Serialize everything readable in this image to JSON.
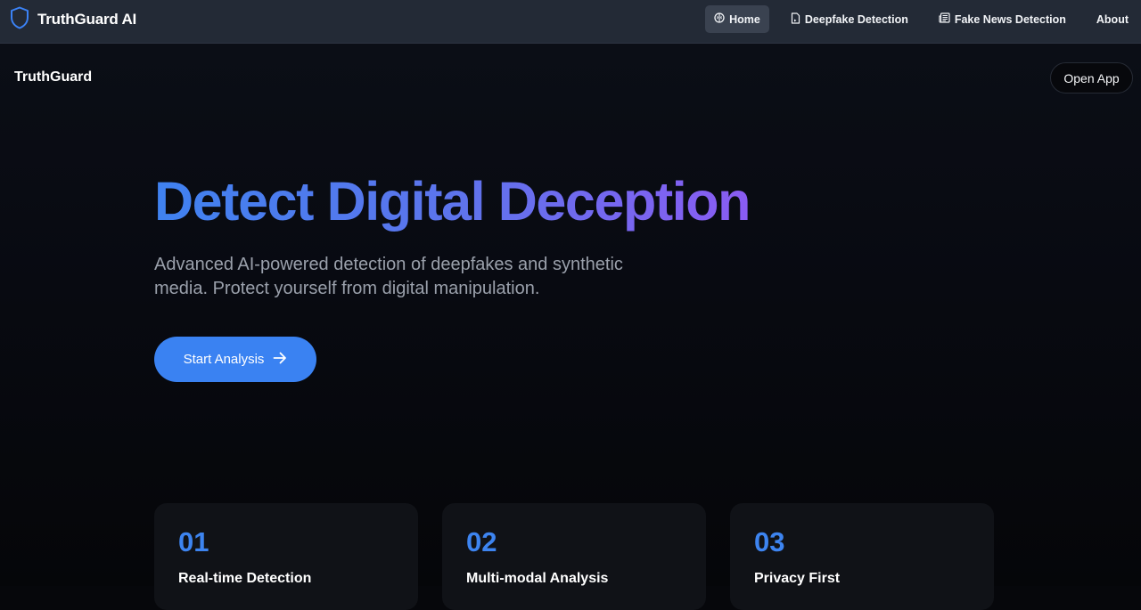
{
  "topbar": {
    "brand": "TruthGuard AI",
    "nav": [
      {
        "label": "Home",
        "icon": "brain-icon",
        "active": true
      },
      {
        "label": "Deepfake Detection",
        "icon": "file-icon"
      },
      {
        "label": "Fake News Detection",
        "icon": "newspaper-icon"
      },
      {
        "label": "About"
      }
    ]
  },
  "header": {
    "brand": "TruthGuard",
    "open_app": "Open App"
  },
  "hero": {
    "title": "Detect Digital Deception",
    "subtitle": "Advanced AI-powered detection of deepfakes and synthetic media. Protect yourself from digital manipulation.",
    "cta": "Start Analysis"
  },
  "features": [
    {
      "number": "01",
      "title": "Real-time Detection"
    },
    {
      "number": "02",
      "title": "Multi-modal Analysis"
    },
    {
      "number": "03",
      "title": "Privacy First"
    }
  ],
  "colors": {
    "accent": "#3a82f2",
    "gradient_start": "#3f82f0",
    "gradient_end": "#8a5cf2",
    "topbar": "#232a36"
  }
}
